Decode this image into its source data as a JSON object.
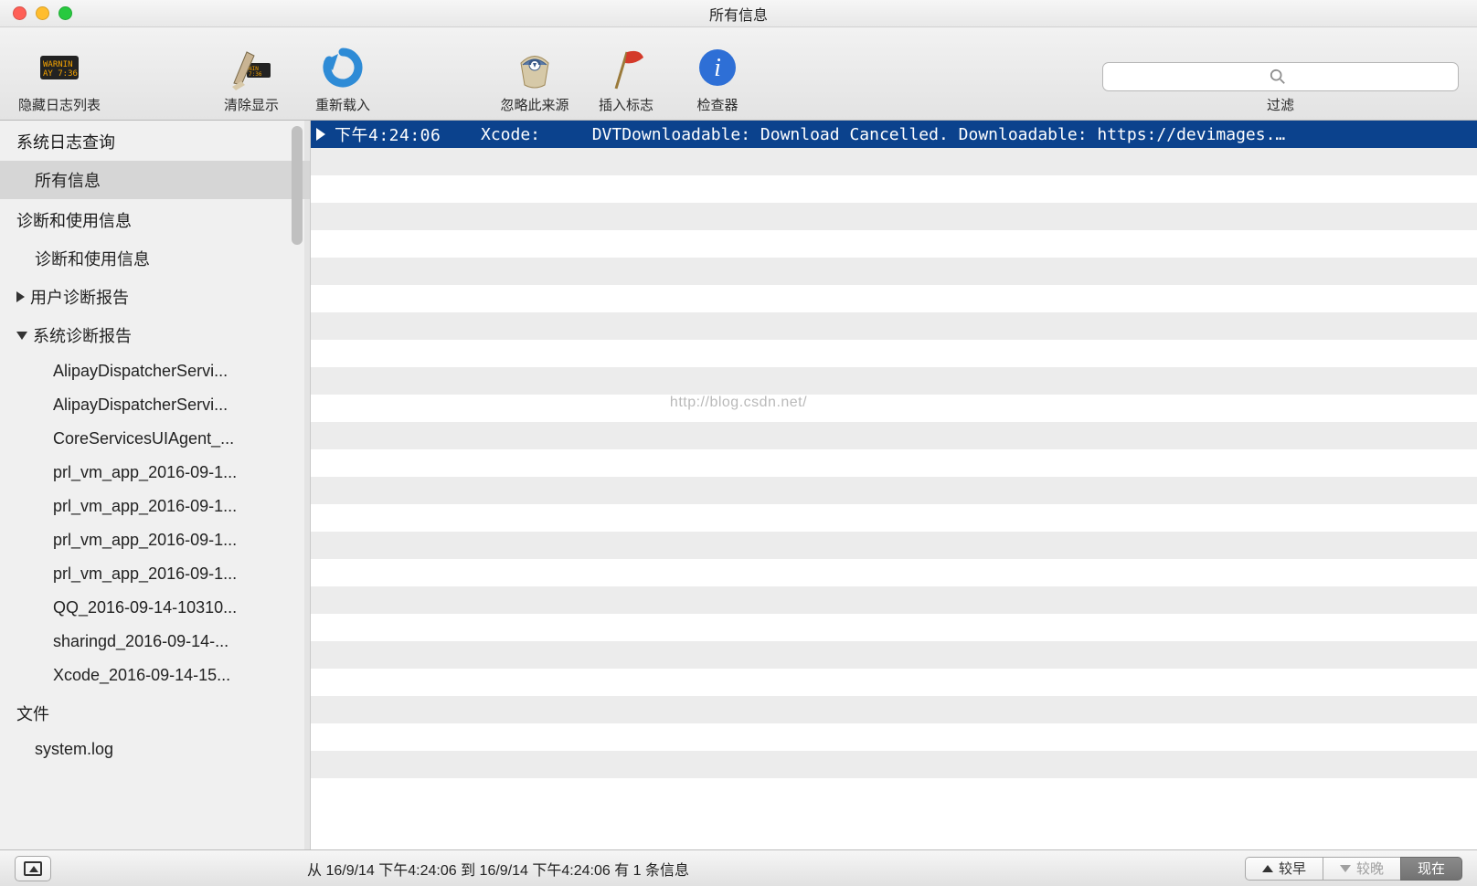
{
  "window": {
    "title": "所有信息"
  },
  "toolbar": {
    "hide_log_list": "隐藏日志列表",
    "clear_display": "清除显示",
    "reload": "重新载入",
    "ignore_source": "忽略此来源",
    "insert_marker": "插入标志",
    "inspector": "检查器",
    "filter_label": "过滤",
    "search_placeholder": ""
  },
  "sidebar": {
    "groups": [
      {
        "header": "系统日志查询",
        "items": [
          {
            "label": "所有信息",
            "selected": true
          }
        ]
      },
      {
        "header": "诊断和使用信息",
        "items": [
          {
            "label": "诊断和使用信息"
          },
          {
            "label": "用户诊断报告",
            "disclosure": "right",
            "indent": 0
          },
          {
            "label": "系统诊断报告",
            "disclosure": "down",
            "indent": 0,
            "children": [
              "AlipayDispatcherServi...",
              "AlipayDispatcherServi...",
              "CoreServicesUIAgent_...",
              "prl_vm_app_2016-09-1...",
              "prl_vm_app_2016-09-1...",
              "prl_vm_app_2016-09-1...",
              "prl_vm_app_2016-09-1...",
              "QQ_2016-09-14-10310...",
              "sharingd_2016-09-14-...",
              "Xcode_2016-09-14-15..."
            ]
          }
        ]
      },
      {
        "header": "文件",
        "items": [
          {
            "label": "system.log"
          }
        ]
      }
    ]
  },
  "log": {
    "rows": [
      {
        "selected": true,
        "timestamp": "下午4:24:06",
        "process": "Xcode:",
        "message": "DVTDownloadable: Download Cancelled. Downloadable: https://devimages.…"
      }
    ],
    "blank_row_count": 24
  },
  "watermark": "http://blog.csdn.net/",
  "statusbar": {
    "range_text": "从 16/9/14 下午4:24:06 到 16/9/14 下午4:24:06 有 1 条信息",
    "earlier": "较早",
    "later": "较晚",
    "now": "现在"
  }
}
